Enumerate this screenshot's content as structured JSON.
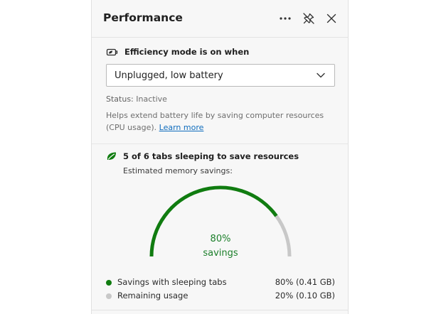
{
  "panel": {
    "title": "Performance",
    "icons": {
      "more": "more-icon",
      "unpin": "unpin-icon",
      "close": "close-icon"
    }
  },
  "efficiency": {
    "icon": "battery-leaf-icon",
    "label": "Efficiency mode is on when",
    "selected_option": "Unplugged, low battery",
    "status_label": "Status:",
    "status_value": "Inactive",
    "help_text": "Helps extend battery life by saving computer resources (CPU usage).",
    "learn_more": "Learn more"
  },
  "sleeping_tabs": {
    "icon": "leaf-icon",
    "summary": "5 of 6 tabs sleeping to save resources",
    "memory_label": "Estimated memory savings:",
    "gauge": {
      "percent_text": "80%",
      "sub_text": "savings",
      "savings_fraction": 0.8
    },
    "legend": [
      {
        "label": "Savings with sleeping tabs",
        "value": "80% (0.41 GB)",
        "color": "#107c10"
      },
      {
        "label": "Remaining usage",
        "value": "20% (0.10 GB)",
        "color": "#c8c8c8"
      }
    ]
  },
  "colors": {
    "accent_green": "#107c10",
    "remaining_gray": "#c8c8c8",
    "link_blue": "#0f6cbd"
  }
}
